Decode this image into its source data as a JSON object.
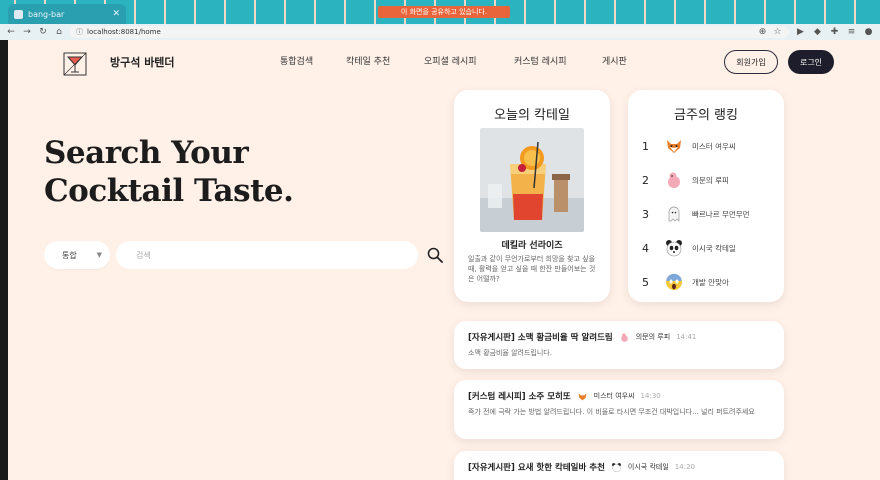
{
  "browser": {
    "tab_title": "bang-bar",
    "tab_close": "✕",
    "share_banner": "이 화면을 공유하고 있습니다.",
    "url": "localhost:8081/home"
  },
  "header": {
    "brand": "방구석 바텐더",
    "nav": [
      "통합검색",
      "칵테일 추천",
      "오피셜 레시피",
      "커스텀 레시피",
      "게시판"
    ],
    "signup_label": "회원가입",
    "login_label": "로그인"
  },
  "hero": {
    "line1": "Search Your",
    "line2": "Cocktail Taste."
  },
  "search": {
    "category": "통합",
    "placeholder": "검색"
  },
  "today_cocktail": {
    "title": "오늘의 칵테일",
    "name": "데킬라 선라이즈",
    "description": "일출과 같이 무언가로부터 희망을 찾고 싶을 때, 활력을 얻고 싶을 때 한잔 만들어보는 것은 어떨까?"
  },
  "weekly_ranking": {
    "title": "금주의 랭킹",
    "items": [
      {
        "rank": "1",
        "name": "미스터 여우씨",
        "icon": "fox-icon"
      },
      {
        "rank": "2",
        "name": "의문의 루피",
        "icon": "pink-dino-icon"
      },
      {
        "rank": "3",
        "name": "빠르나르 무먼무먼",
        "icon": "ghost-icon"
      },
      {
        "rank": "4",
        "name": "이시국 칵테일",
        "icon": "panda-icon"
      },
      {
        "rank": "5",
        "name": "개발 안맞아",
        "icon": "screaming-face-icon"
      }
    ]
  },
  "posts": [
    {
      "title": "[자유게시판] 소맥 황금비율 딱 알려드림",
      "author": "의문의 루피",
      "icon": "pink-dino-icon",
      "time": "14:41",
      "body": "소맥 황금비율 알려드립니다."
    },
    {
      "title": "[커스텀 레시피] 소주 모히또",
      "author": "미스터 여우씨",
      "icon": "fox-icon",
      "time": "14:30",
      "body": "죽가 전에 극락 가는 방법 알려드립니다. 이 비율로 타시면 무조건 대박입니다... 널리 퍼트려주세요"
    },
    {
      "title": "[자유게시판] 요새 핫한 칵테일바 추천",
      "author": "이시국 칵테일",
      "icon": "panda-icon",
      "time": "14:20",
      "body": ""
    }
  ],
  "colors": {
    "page_bg": "#fff1e8",
    "tab_strip": "#2bb3c0",
    "dark_button": "#1d1d2b",
    "share_banner": "#e8643a"
  }
}
